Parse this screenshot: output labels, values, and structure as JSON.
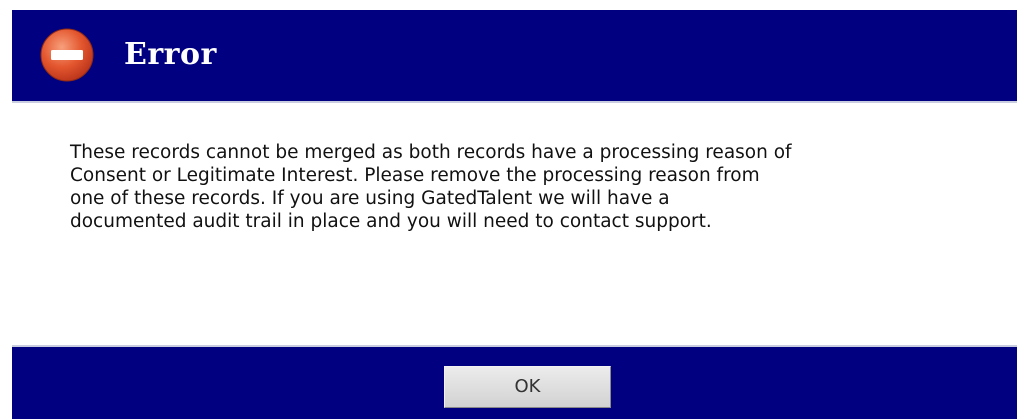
{
  "dialog": {
    "title": "Error",
    "icon": "error-stop-icon",
    "message_lines": [
      "These records cannot be merged as both records have a processing reason of",
      "Consent or Legitimate Interest.  Please remove the processing reason from",
      "one of these records.  If you are using GatedTalent we will have a",
      "documented audit trail in place and you will need to contact support."
    ],
    "ok_label": "OK"
  },
  "colors": {
    "header_bg": "#000080",
    "footer_bg": "#000080",
    "icon_red": "#e0502a",
    "text": "#111111"
  }
}
